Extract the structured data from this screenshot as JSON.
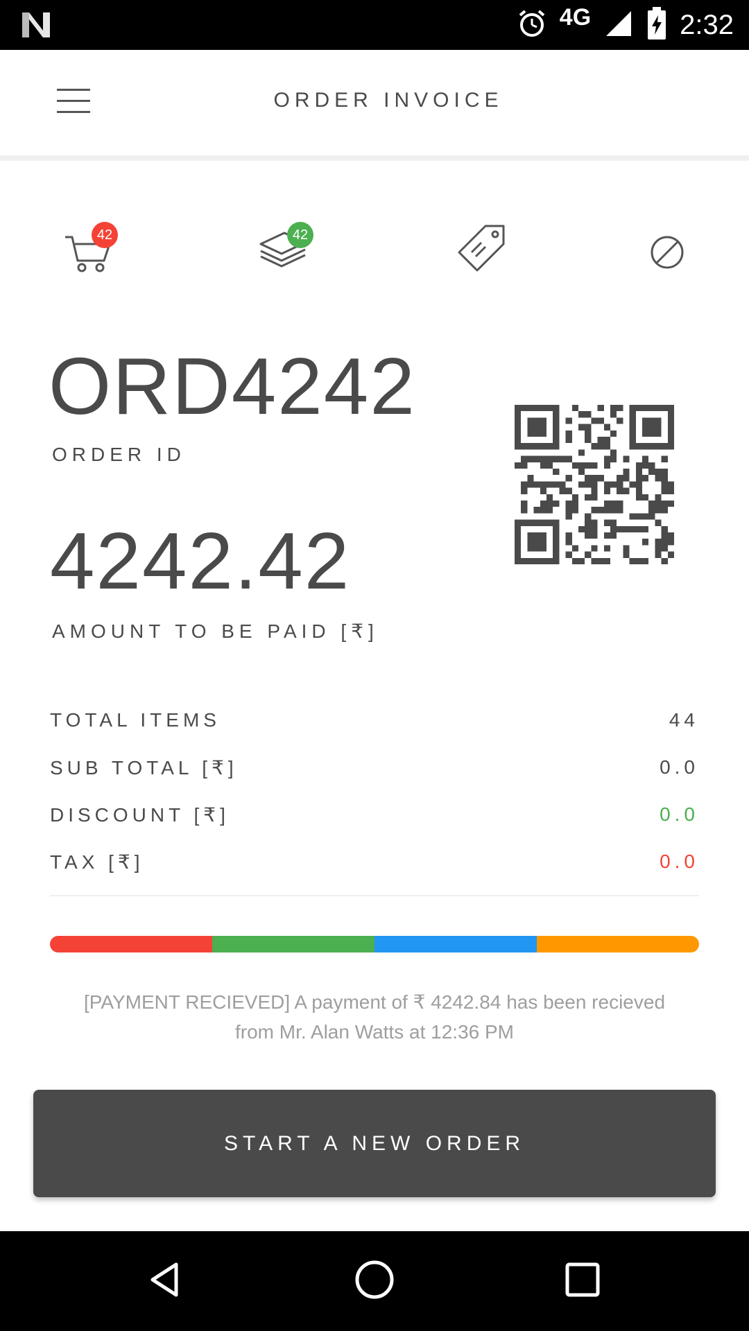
{
  "status_bar": {
    "network": "4G",
    "time": "2:32"
  },
  "app_bar": {
    "title": "ORDER INVOICE"
  },
  "icons": {
    "cart_badge": "42",
    "layers_badge": "42",
    "badge_colors": {
      "cart": "#f44336",
      "layers": "#4caf50"
    }
  },
  "order": {
    "id_value": "ORD4242",
    "id_label": "ORDER ID",
    "amount_value": "4242.42",
    "amount_label": "AMOUNT TO BE PAID [₹]"
  },
  "summary": [
    {
      "label": "TOTAL ITEMS",
      "value": "44",
      "color": "#4a4a4a"
    },
    {
      "label": "SUB TOTAL [₹]",
      "value": "0.0",
      "color": "#4a4a4a"
    },
    {
      "label": "DISCOUNT [₹]",
      "value": "0.0",
      "color": "#4caf50"
    },
    {
      "label": "TAX [₹]",
      "value": "0.0",
      "color": "#f44336"
    }
  ],
  "progress_colors": [
    "#f44336",
    "#4caf50",
    "#2196f3",
    "#ff9800"
  ],
  "message": "[PAYMENT RECIEVED] A payment of ₹ 4242.84 has been recieved from Mr. Alan Watts at 12:36 PM",
  "cta_label": "START A NEW ORDER"
}
